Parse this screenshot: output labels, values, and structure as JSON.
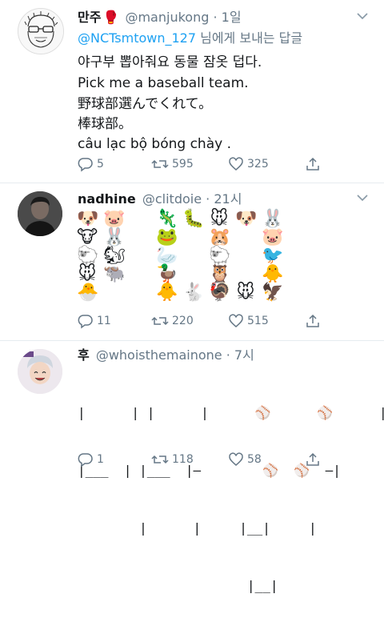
{
  "tweets": [
    {
      "name": "만주",
      "name_emoji": "🥊",
      "handle": "@manjukong",
      "time": "1일",
      "reply_mention": "@NCTsmtown_127",
      "reply_suffix": " 님에게 보내는 답글",
      "lines": [
        "야구부 뽑아줘요 동물 잠옷 덥다.",
        "Pick me a baseball team.",
        "野球部選んでくれて。",
        "棒球部。",
        "câu lạc bộ bóng chày ."
      ],
      "replies": "5",
      "retweets": "595",
      "likes": "325"
    },
    {
      "name": "nadhine",
      "handle": "@clitdoie",
      "time": "21시",
      "emoji_rows": [
        [
          "🐶",
          "🐷",
          "",
          "🦎",
          "🐛",
          "🐭",
          "🐶",
          "🐰"
        ],
        [
          "🐮",
          "🐰",
          "",
          "🐸",
          "",
          "🐹",
          "",
          "🐷"
        ],
        [
          "🐑",
          "🐿",
          "",
          "🦢",
          "",
          "🐑",
          "",
          "🐦"
        ],
        [
          "🐭",
          "🐃",
          "",
          "🦆",
          "",
          "🦉",
          "",
          "🐥"
        ],
        [
          "🐣",
          "",
          "",
          "🐥",
          "🐇",
          "🦃",
          "🐭",
          "🦅"
        ]
      ],
      "replies": "11",
      "retweets": "220",
      "likes": "515"
    },
    {
      "name": "후",
      "handle": "@whoisthemainone",
      "time": "7시",
      "ascii_lines": [
        "|      | |      |      ⚾      ⚾      |",
        "|___  | |___  |—        ⚾  ⚾  —|",
        "        |      |     |__|     |",
        "                      |__|"
      ],
      "replies": "1",
      "retweets": "118",
      "likes": "58"
    }
  ],
  "icons": {
    "reply": "speech-bubble-icon",
    "retweet": "retweet-icon",
    "like": "heart-icon",
    "share": "share-icon",
    "caret": "chevron-down-icon"
  },
  "colors": {
    "link": "#1da1f2",
    "secondary": "#657786",
    "divider": "#e6ecf0"
  }
}
